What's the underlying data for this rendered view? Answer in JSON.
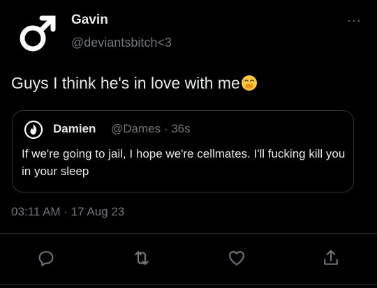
{
  "tweet": {
    "display_name": "Gavin",
    "handle": "@deviantsbitch<3",
    "avatar_icon": "male-symbol-icon",
    "more_icon": "more-options-icon",
    "more_label": "···",
    "text": "Guys I think he's in love with me",
    "emoji_icon": "face-with-hand-over-mouth-emoji",
    "timestamp": "03:11 AM · 17 Aug 23"
  },
  "quote": {
    "avatar_icon": "flame-logo-icon",
    "display_name": "Damien",
    "handle_time": "@Dames · 36s",
    "text": "If we're going to jail, I hope we're cellmates. I'll fucking kill you in your sleep"
  },
  "actions": [
    {
      "name": "reply",
      "icon": "reply-icon"
    },
    {
      "name": "retweet",
      "icon": "retweet-icon"
    },
    {
      "name": "like",
      "icon": "heart-icon"
    },
    {
      "name": "share",
      "icon": "share-icon"
    }
  ],
  "colors": {
    "background": "#000000",
    "text_primary": "#e7e9ea",
    "text_secondary": "#71767b",
    "border": "#2f3336",
    "emoji": "#ffc83d"
  }
}
